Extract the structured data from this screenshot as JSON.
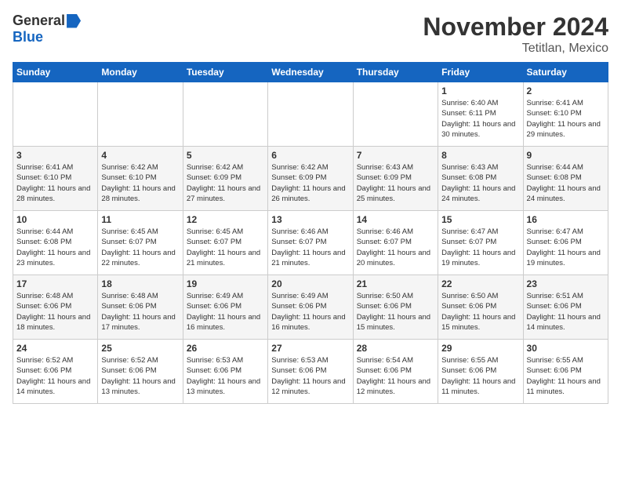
{
  "header": {
    "logo_general": "General",
    "logo_blue": "Blue",
    "month_title": "November 2024",
    "location": "Tetitlan, Mexico"
  },
  "days_of_week": [
    "Sunday",
    "Monday",
    "Tuesday",
    "Wednesday",
    "Thursday",
    "Friday",
    "Saturday"
  ],
  "weeks": [
    [
      {
        "day": "",
        "info": ""
      },
      {
        "day": "",
        "info": ""
      },
      {
        "day": "",
        "info": ""
      },
      {
        "day": "",
        "info": ""
      },
      {
        "day": "",
        "info": ""
      },
      {
        "day": "1",
        "info": "Sunrise: 6:40 AM\nSunset: 6:11 PM\nDaylight: 11 hours and 30 minutes."
      },
      {
        "day": "2",
        "info": "Sunrise: 6:41 AM\nSunset: 6:10 PM\nDaylight: 11 hours and 29 minutes."
      }
    ],
    [
      {
        "day": "3",
        "info": "Sunrise: 6:41 AM\nSunset: 6:10 PM\nDaylight: 11 hours and 28 minutes."
      },
      {
        "day": "4",
        "info": "Sunrise: 6:42 AM\nSunset: 6:10 PM\nDaylight: 11 hours and 28 minutes."
      },
      {
        "day": "5",
        "info": "Sunrise: 6:42 AM\nSunset: 6:09 PM\nDaylight: 11 hours and 27 minutes."
      },
      {
        "day": "6",
        "info": "Sunrise: 6:42 AM\nSunset: 6:09 PM\nDaylight: 11 hours and 26 minutes."
      },
      {
        "day": "7",
        "info": "Sunrise: 6:43 AM\nSunset: 6:09 PM\nDaylight: 11 hours and 25 minutes."
      },
      {
        "day": "8",
        "info": "Sunrise: 6:43 AM\nSunset: 6:08 PM\nDaylight: 11 hours and 24 minutes."
      },
      {
        "day": "9",
        "info": "Sunrise: 6:44 AM\nSunset: 6:08 PM\nDaylight: 11 hours and 24 minutes."
      }
    ],
    [
      {
        "day": "10",
        "info": "Sunrise: 6:44 AM\nSunset: 6:08 PM\nDaylight: 11 hours and 23 minutes."
      },
      {
        "day": "11",
        "info": "Sunrise: 6:45 AM\nSunset: 6:07 PM\nDaylight: 11 hours and 22 minutes."
      },
      {
        "day": "12",
        "info": "Sunrise: 6:45 AM\nSunset: 6:07 PM\nDaylight: 11 hours and 21 minutes."
      },
      {
        "day": "13",
        "info": "Sunrise: 6:46 AM\nSunset: 6:07 PM\nDaylight: 11 hours and 21 minutes."
      },
      {
        "day": "14",
        "info": "Sunrise: 6:46 AM\nSunset: 6:07 PM\nDaylight: 11 hours and 20 minutes."
      },
      {
        "day": "15",
        "info": "Sunrise: 6:47 AM\nSunset: 6:07 PM\nDaylight: 11 hours and 19 minutes."
      },
      {
        "day": "16",
        "info": "Sunrise: 6:47 AM\nSunset: 6:06 PM\nDaylight: 11 hours and 19 minutes."
      }
    ],
    [
      {
        "day": "17",
        "info": "Sunrise: 6:48 AM\nSunset: 6:06 PM\nDaylight: 11 hours and 18 minutes."
      },
      {
        "day": "18",
        "info": "Sunrise: 6:48 AM\nSunset: 6:06 PM\nDaylight: 11 hours and 17 minutes."
      },
      {
        "day": "19",
        "info": "Sunrise: 6:49 AM\nSunset: 6:06 PM\nDaylight: 11 hours and 16 minutes."
      },
      {
        "day": "20",
        "info": "Sunrise: 6:49 AM\nSunset: 6:06 PM\nDaylight: 11 hours and 16 minutes."
      },
      {
        "day": "21",
        "info": "Sunrise: 6:50 AM\nSunset: 6:06 PM\nDaylight: 11 hours and 15 minutes."
      },
      {
        "day": "22",
        "info": "Sunrise: 6:50 AM\nSunset: 6:06 PM\nDaylight: 11 hours and 15 minutes."
      },
      {
        "day": "23",
        "info": "Sunrise: 6:51 AM\nSunset: 6:06 PM\nDaylight: 11 hours and 14 minutes."
      }
    ],
    [
      {
        "day": "24",
        "info": "Sunrise: 6:52 AM\nSunset: 6:06 PM\nDaylight: 11 hours and 14 minutes."
      },
      {
        "day": "25",
        "info": "Sunrise: 6:52 AM\nSunset: 6:06 PM\nDaylight: 11 hours and 13 minutes."
      },
      {
        "day": "26",
        "info": "Sunrise: 6:53 AM\nSunset: 6:06 PM\nDaylight: 11 hours and 13 minutes."
      },
      {
        "day": "27",
        "info": "Sunrise: 6:53 AM\nSunset: 6:06 PM\nDaylight: 11 hours and 12 minutes."
      },
      {
        "day": "28",
        "info": "Sunrise: 6:54 AM\nSunset: 6:06 PM\nDaylight: 11 hours and 12 minutes."
      },
      {
        "day": "29",
        "info": "Sunrise: 6:55 AM\nSunset: 6:06 PM\nDaylight: 11 hours and 11 minutes."
      },
      {
        "day": "30",
        "info": "Sunrise: 6:55 AM\nSunset: 6:06 PM\nDaylight: 11 hours and 11 minutes."
      }
    ]
  ]
}
